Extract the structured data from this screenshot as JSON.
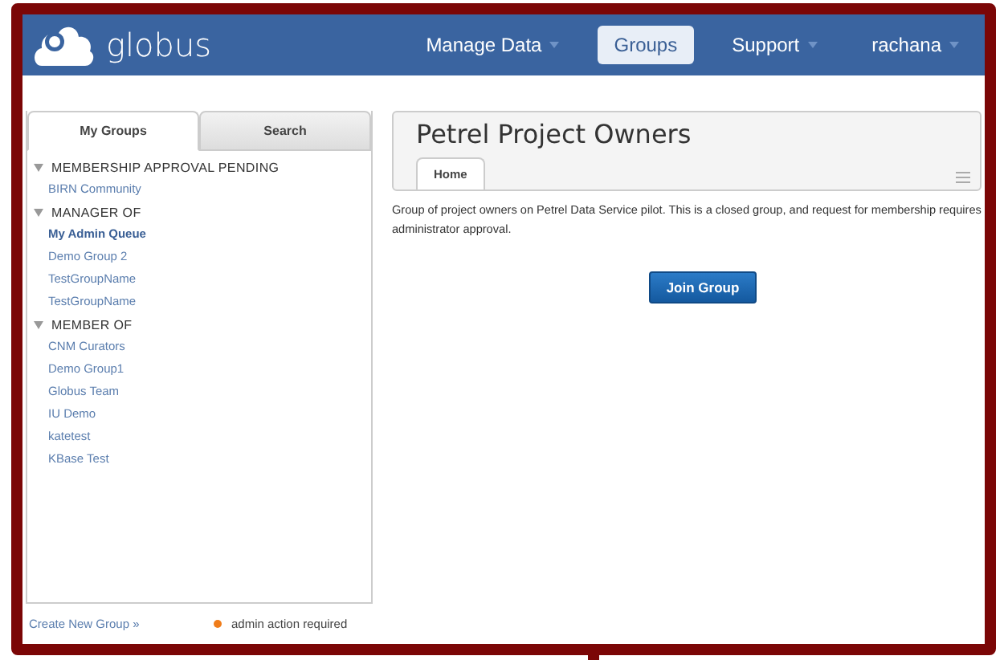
{
  "header": {
    "logo_text": "globus",
    "nav": [
      {
        "label": "Manage Data",
        "selected": false,
        "has_menu": true
      },
      {
        "label": "Groups",
        "selected": true,
        "has_menu": false
      },
      {
        "label": "Support",
        "selected": false,
        "has_menu": true
      },
      {
        "label": "rachana",
        "selected": false,
        "has_menu": true
      }
    ]
  },
  "sidebar": {
    "tabs": [
      {
        "label": "My Groups",
        "selected": true
      },
      {
        "label": "Search",
        "selected": false
      }
    ],
    "sections": [
      {
        "title": "MEMBERSHIP APPROVAL PENDING",
        "expanded": true,
        "items": [
          {
            "label": "BIRN Community",
            "selected": false
          }
        ]
      },
      {
        "title": "MANAGER OF",
        "expanded": true,
        "items": [
          {
            "label": "My Admin Queue",
            "selected": true
          },
          {
            "label": "Demo Group 2",
            "selected": false
          },
          {
            "label": "TestGroupName",
            "selected": false
          },
          {
            "label": "TestGroupName",
            "selected": false
          }
        ]
      },
      {
        "title": "MEMBER OF",
        "expanded": true,
        "items": [
          {
            "label": "CNM Curators",
            "selected": false
          },
          {
            "label": "Demo Group1",
            "selected": false
          },
          {
            "label": "Globus Team",
            "selected": false
          },
          {
            "label": "IU Demo",
            "selected": false
          },
          {
            "label": "katetest",
            "selected": false
          },
          {
            "label": "KBase Test",
            "selected": false
          }
        ]
      }
    ],
    "create_link": "Create New Group »",
    "legend": {
      "label": "admin action required",
      "color": "#f07d1a"
    }
  },
  "group": {
    "title": "Petrel Project Owners",
    "tabs": [
      {
        "label": "Home",
        "selected": true
      }
    ],
    "description": "Group of project owners on Petrel Data Service pilot. This is a closed group, and request for membership requires administrator approval.",
    "join_button": "Join Group"
  }
}
